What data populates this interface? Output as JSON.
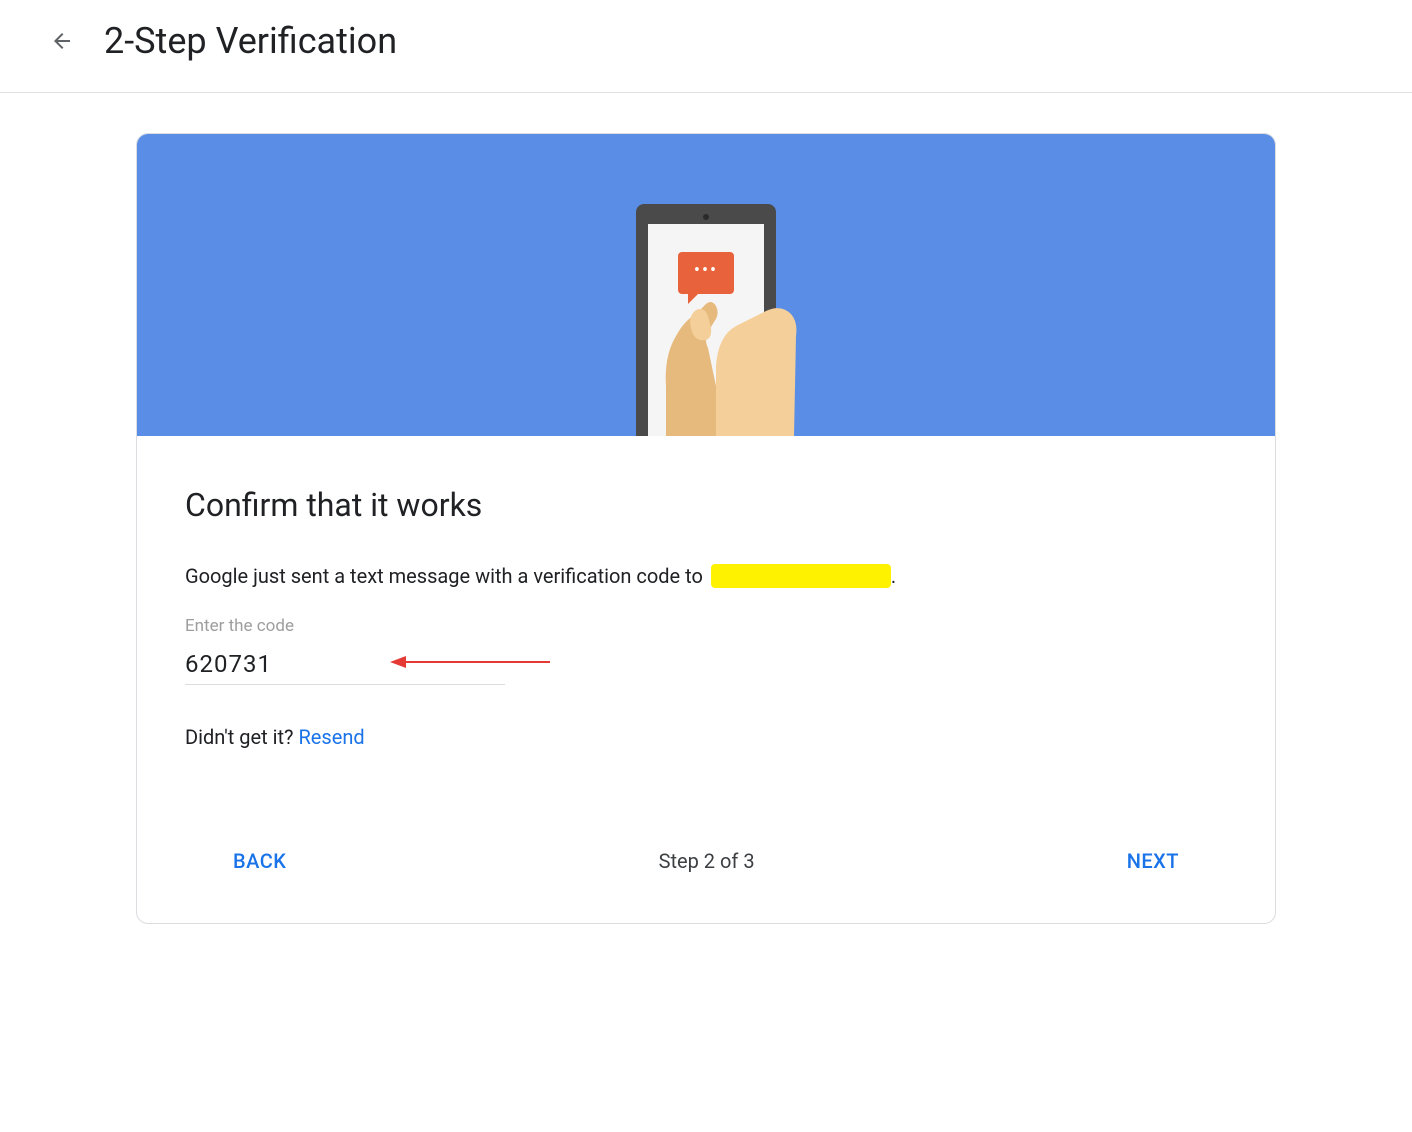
{
  "header": {
    "title": "2-Step Verification"
  },
  "card": {
    "section_title": "Confirm that it works",
    "description_prefix": "Google just sent a text message with a verification code to",
    "description_suffix": ".",
    "input_label": "Enter the code",
    "code_value": "620731",
    "resend_prompt": "Didn't get it?",
    "resend_link": "Resend"
  },
  "footer": {
    "back_label": "BACK",
    "step_text": "Step 2 of 3",
    "next_label": "NEXT"
  },
  "colors": {
    "blue": "#1a73e8",
    "banner": "#5a8ee6",
    "highlight": "#fff200",
    "message": "#e8633b"
  }
}
